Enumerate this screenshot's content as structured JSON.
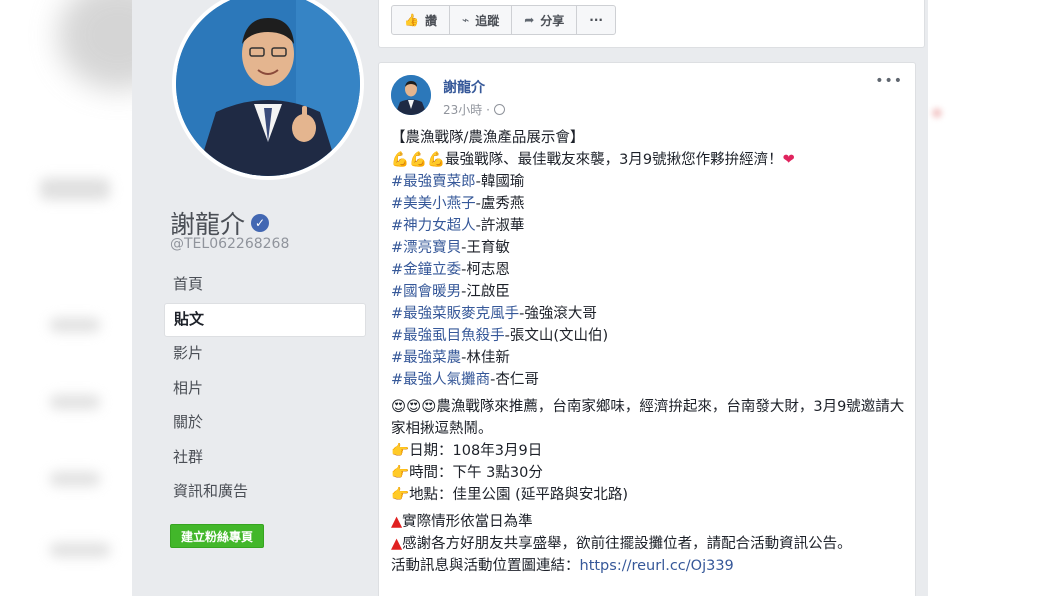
{
  "profile": {
    "name": "謝龍介",
    "handle": "@TEL062268268"
  },
  "nav": {
    "items": [
      "首頁",
      "貼文",
      "影片",
      "相片",
      "關於",
      "社群",
      "資訊和廣告"
    ],
    "active_index": 1
  },
  "create_page_button": "建立粉絲專頁",
  "actions": {
    "like": "讚",
    "follow": "追蹤",
    "share": "分享",
    "more": "···"
  },
  "post": {
    "author": "謝龍介",
    "time": "23小時 · ",
    "more": "•••",
    "title": "【農漁戰隊/農漁產品展示會】",
    "intro_emoji": "💪💪💪",
    "intro_text": "最強戰隊、最佳戰友來襲，3月9號揪您作夥拚經濟！",
    "intro_heart": "❤",
    "members": [
      {
        "tag": "#最強賣菜郎",
        "name": "-韓國瑜"
      },
      {
        "tag": "#美美小燕子",
        "name": "-盧秀燕"
      },
      {
        "tag": "#神力女超人",
        "name": "-許淑華"
      },
      {
        "tag": "#漂亮寶貝",
        "name": "-王育敏"
      },
      {
        "tag": "#金鐘立委",
        "name": "-柯志恩"
      },
      {
        "tag": "#國會暖男",
        "name": "-江啟臣"
      },
      {
        "tag": "#最強菜販麥克風手",
        "name": "-強強滾大哥"
      },
      {
        "tag": "#最強虱目魚殺手",
        "name": "-張文山(文山伯)"
      },
      {
        "tag": "#最強菜農",
        "name": "-林佳新"
      },
      {
        "tag": "#最強人氣攤商",
        "name": "-杏仁哥"
      }
    ],
    "promo_emoji": "😍😍😍",
    "promo_text": "農漁戰隊來推薦，台南家鄉味，經濟拚起來，台南發大財，3月9號邀請大家相揪逗熱鬧。",
    "details": [
      {
        "icon": "👉",
        "text": "日期：108年3月9日"
      },
      {
        "icon": "👉",
        "text": "時間：下午 3點30分"
      },
      {
        "icon": "👉",
        "text": "地點：佳里公園 (延平路與安北路)"
      }
    ],
    "notes": [
      {
        "icon": "▲",
        "text": "實際情形依當日為準"
      },
      {
        "icon": "▲",
        "text": "感謝各方好朋友共享盛舉，欲前往擺設攤位者，請配合活動資訊公告。"
      }
    ],
    "link_label": "活動訊息與活動位置圖連結：",
    "link_url": "https://reurl.cc/Oj339"
  }
}
